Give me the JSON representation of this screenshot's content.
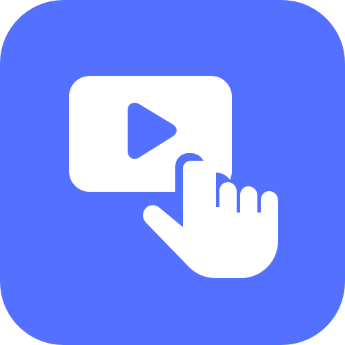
{
  "app_icon": {
    "icon_name": "video-tap-icon",
    "background_color": "#5470FE",
    "foreground_color": "#FFFFFF",
    "player_icon": "play-video-icon",
    "pointer_icon": "hand-pointer-icon"
  }
}
